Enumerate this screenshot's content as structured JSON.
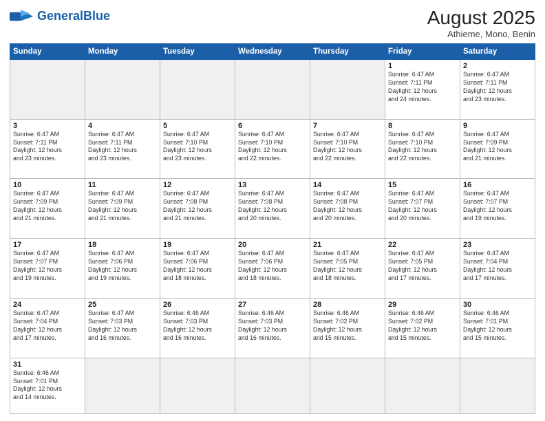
{
  "logo": {
    "text_general": "General",
    "text_blue": "Blue"
  },
  "header": {
    "title": "August 2025",
    "subtitle": "Athieme, Mono, Benin"
  },
  "weekdays": [
    "Sunday",
    "Monday",
    "Tuesday",
    "Wednesday",
    "Thursday",
    "Friday",
    "Saturday"
  ],
  "weeks": [
    [
      {
        "day": "",
        "info": "",
        "empty": true
      },
      {
        "day": "",
        "info": "",
        "empty": true
      },
      {
        "day": "",
        "info": "",
        "empty": true
      },
      {
        "day": "",
        "info": "",
        "empty": true
      },
      {
        "day": "",
        "info": "",
        "empty": true
      },
      {
        "day": "1",
        "info": "Sunrise: 6:47 AM\nSunset: 7:11 PM\nDaylight: 12 hours\nand 24 minutes."
      },
      {
        "day": "2",
        "info": "Sunrise: 6:47 AM\nSunset: 7:11 PM\nDaylight: 12 hours\nand 23 minutes."
      }
    ],
    [
      {
        "day": "3",
        "info": "Sunrise: 6:47 AM\nSunset: 7:11 PM\nDaylight: 12 hours\nand 23 minutes."
      },
      {
        "day": "4",
        "info": "Sunrise: 6:47 AM\nSunset: 7:11 PM\nDaylight: 12 hours\nand 23 minutes."
      },
      {
        "day": "5",
        "info": "Sunrise: 6:47 AM\nSunset: 7:10 PM\nDaylight: 12 hours\nand 23 minutes."
      },
      {
        "day": "6",
        "info": "Sunrise: 6:47 AM\nSunset: 7:10 PM\nDaylight: 12 hours\nand 22 minutes."
      },
      {
        "day": "7",
        "info": "Sunrise: 6:47 AM\nSunset: 7:10 PM\nDaylight: 12 hours\nand 22 minutes."
      },
      {
        "day": "8",
        "info": "Sunrise: 6:47 AM\nSunset: 7:10 PM\nDaylight: 12 hours\nand 22 minutes."
      },
      {
        "day": "9",
        "info": "Sunrise: 6:47 AM\nSunset: 7:09 PM\nDaylight: 12 hours\nand 21 minutes."
      }
    ],
    [
      {
        "day": "10",
        "info": "Sunrise: 6:47 AM\nSunset: 7:09 PM\nDaylight: 12 hours\nand 21 minutes."
      },
      {
        "day": "11",
        "info": "Sunrise: 6:47 AM\nSunset: 7:09 PM\nDaylight: 12 hours\nand 21 minutes."
      },
      {
        "day": "12",
        "info": "Sunrise: 6:47 AM\nSunset: 7:08 PM\nDaylight: 12 hours\nand 21 minutes."
      },
      {
        "day": "13",
        "info": "Sunrise: 6:47 AM\nSunset: 7:08 PM\nDaylight: 12 hours\nand 20 minutes."
      },
      {
        "day": "14",
        "info": "Sunrise: 6:47 AM\nSunset: 7:08 PM\nDaylight: 12 hours\nand 20 minutes."
      },
      {
        "day": "15",
        "info": "Sunrise: 6:47 AM\nSunset: 7:07 PM\nDaylight: 12 hours\nand 20 minutes."
      },
      {
        "day": "16",
        "info": "Sunrise: 6:47 AM\nSunset: 7:07 PM\nDaylight: 12 hours\nand 19 minutes."
      }
    ],
    [
      {
        "day": "17",
        "info": "Sunrise: 6:47 AM\nSunset: 7:07 PM\nDaylight: 12 hours\nand 19 minutes."
      },
      {
        "day": "18",
        "info": "Sunrise: 6:47 AM\nSunset: 7:06 PM\nDaylight: 12 hours\nand 19 minutes."
      },
      {
        "day": "19",
        "info": "Sunrise: 6:47 AM\nSunset: 7:06 PM\nDaylight: 12 hours\nand 18 minutes."
      },
      {
        "day": "20",
        "info": "Sunrise: 6:47 AM\nSunset: 7:06 PM\nDaylight: 12 hours\nand 18 minutes."
      },
      {
        "day": "21",
        "info": "Sunrise: 6:47 AM\nSunset: 7:05 PM\nDaylight: 12 hours\nand 18 minutes."
      },
      {
        "day": "22",
        "info": "Sunrise: 6:47 AM\nSunset: 7:05 PM\nDaylight: 12 hours\nand 17 minutes."
      },
      {
        "day": "23",
        "info": "Sunrise: 6:47 AM\nSunset: 7:04 PM\nDaylight: 12 hours\nand 17 minutes."
      }
    ],
    [
      {
        "day": "24",
        "info": "Sunrise: 6:47 AM\nSunset: 7:04 PM\nDaylight: 12 hours\nand 17 minutes."
      },
      {
        "day": "25",
        "info": "Sunrise: 6:47 AM\nSunset: 7:03 PM\nDaylight: 12 hours\nand 16 minutes."
      },
      {
        "day": "26",
        "info": "Sunrise: 6:46 AM\nSunset: 7:03 PM\nDaylight: 12 hours\nand 16 minutes."
      },
      {
        "day": "27",
        "info": "Sunrise: 6:46 AM\nSunset: 7:03 PM\nDaylight: 12 hours\nand 16 minutes."
      },
      {
        "day": "28",
        "info": "Sunrise: 6:46 AM\nSunset: 7:02 PM\nDaylight: 12 hours\nand 15 minutes."
      },
      {
        "day": "29",
        "info": "Sunrise: 6:46 AM\nSunset: 7:02 PM\nDaylight: 12 hours\nand 15 minutes."
      },
      {
        "day": "30",
        "info": "Sunrise: 6:46 AM\nSunset: 7:01 PM\nDaylight: 12 hours\nand 15 minutes."
      }
    ],
    [
      {
        "day": "31",
        "info": "Sunrise: 6:46 AM\nSunset: 7:01 PM\nDaylight: 12 hours\nand 14 minutes."
      },
      {
        "day": "",
        "info": "",
        "empty": true
      },
      {
        "day": "",
        "info": "",
        "empty": true
      },
      {
        "day": "",
        "info": "",
        "empty": true
      },
      {
        "day": "",
        "info": "",
        "empty": true
      },
      {
        "day": "",
        "info": "",
        "empty": true
      },
      {
        "day": "",
        "info": "",
        "empty": true
      }
    ]
  ]
}
